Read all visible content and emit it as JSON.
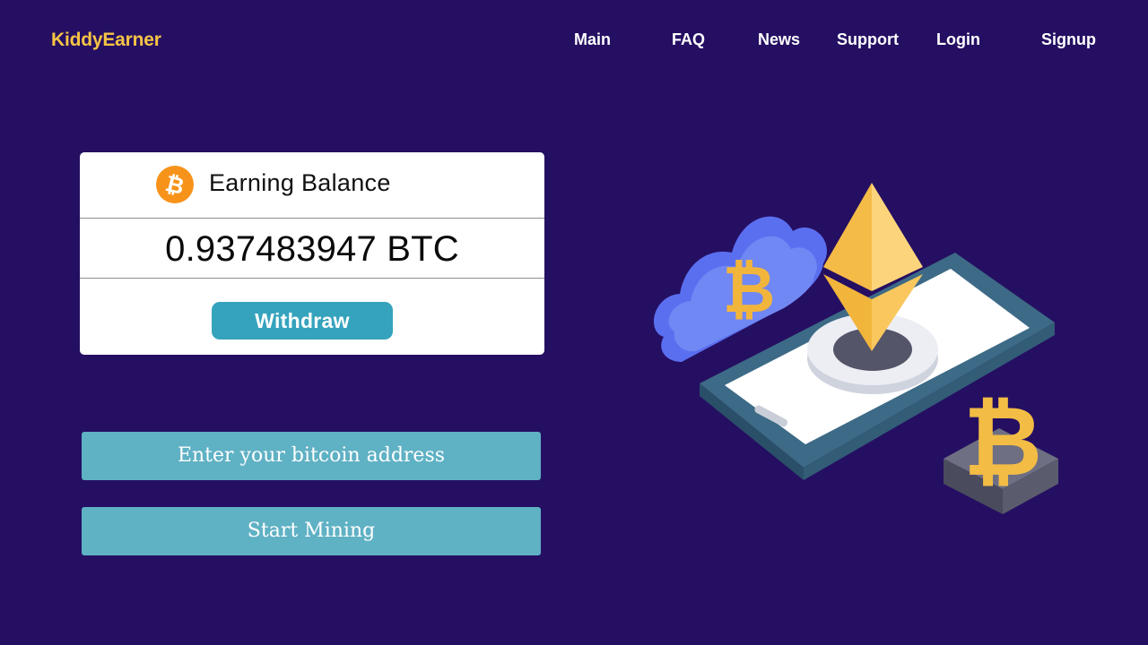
{
  "header": {
    "brand": "KiddyEarner",
    "nav": [
      {
        "label": "Main"
      },
      {
        "label": "FAQ"
      },
      {
        "label": "News"
      },
      {
        "label": "Support"
      },
      {
        "label": "Login"
      },
      {
        "label": "Signup"
      }
    ]
  },
  "balance_card": {
    "title": "Earning Balance",
    "amount": "0.937483947 BTC",
    "withdraw_label": "Withdraw",
    "coin_icon": "bitcoin-icon"
  },
  "form": {
    "address_placeholder": "Enter your bitcoin address",
    "start_label": "Start Mining"
  },
  "illustration": {
    "name": "crypto-mining-illustration"
  },
  "colors": {
    "background": "#250f62",
    "brand": "#f6c445",
    "bitcoin": "#f7931a",
    "withdraw": "#36a3bd",
    "button": "#5fb1c4"
  }
}
